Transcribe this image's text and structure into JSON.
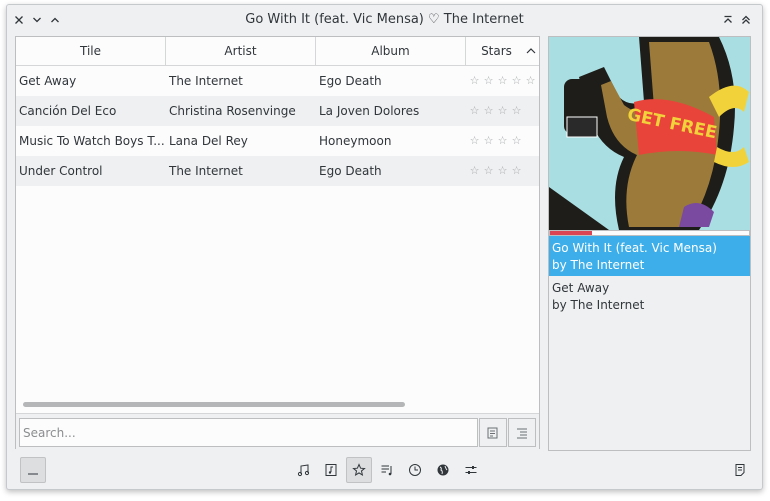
{
  "window": {
    "title": "Go With It (feat. Vic Mensa) ♡ The Internet"
  },
  "table": {
    "columns": [
      "Tile",
      "Artist",
      "Album",
      "Stars"
    ],
    "rows": [
      {
        "title": "Get Away",
        "artist": "The Internet",
        "album": "Ego Death",
        "stars": 0
      },
      {
        "title": "Canción Del Eco",
        "artist": "Christina Rosenvinge",
        "album": "La Joven Dolores",
        "stars": 0
      },
      {
        "title": "Music To Watch Boys T...",
        "artist": "Lana Del Rey",
        "album": "Honeymoon",
        "stars": 0
      },
      {
        "title": "Under Control",
        "artist": "The Internet",
        "album": "Ego Death",
        "stars": 0
      }
    ],
    "star_glyph": "☆"
  },
  "search": {
    "placeholder": "Search..."
  },
  "player": {
    "progress_fraction": 0.21,
    "cover_text": "GET FREE",
    "queue": [
      {
        "title": "Go With It (feat. Vic Mensa)",
        "by": "by The Internet",
        "current": true
      },
      {
        "title": "Get Away",
        "by": "by The Internet",
        "current": false
      }
    ]
  },
  "toolbar": {
    "left_button_label": "...",
    "tools": [
      "music-note-icon",
      "music-file-icon",
      "star-icon",
      "playlist-icon",
      "clock-icon",
      "globe-icon",
      "settings-sliders-icon"
    ],
    "active_tool": "star-icon"
  },
  "colors": {
    "accent": "#3daee9",
    "progress": "#da4453",
    "window_bg": "#eff0f1"
  }
}
